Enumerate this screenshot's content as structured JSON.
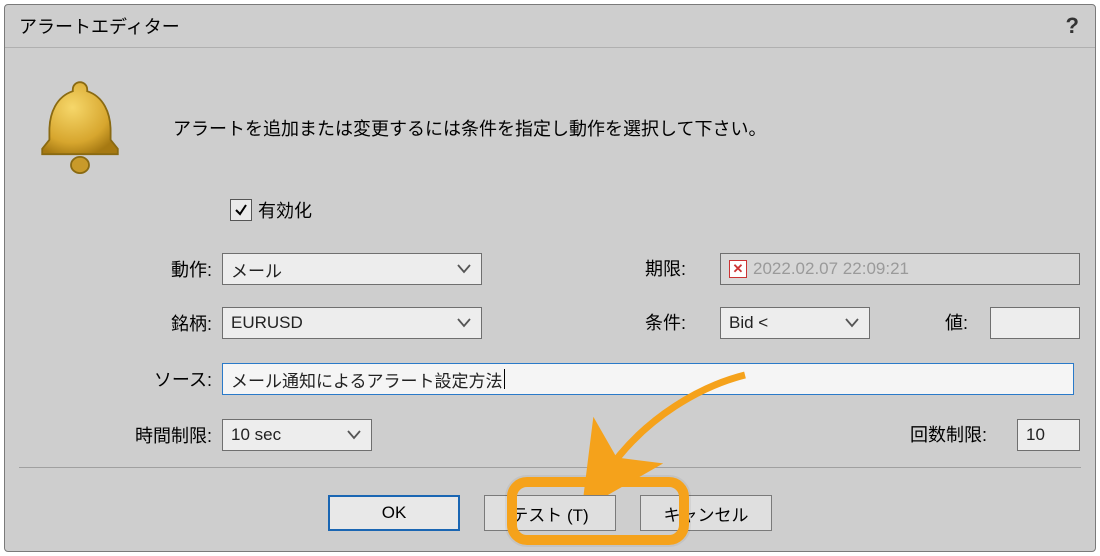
{
  "titlebar": {
    "title": "アラートエディター",
    "help_tooltip": "?"
  },
  "instruction": "アラートを追加または変更するには条件を指定し動作を選択して下さい。",
  "enable": {
    "label": "有効化",
    "checked": true
  },
  "labels": {
    "action": "動作:",
    "symbol": "銘柄:",
    "source": "ソース:",
    "time_limit": "時間制限:",
    "expiry": "期限:",
    "condition": "条件:",
    "value": "値:",
    "count_limit": "回数制限:"
  },
  "values": {
    "action": "メール",
    "symbol": "EURUSD",
    "source": "メール通知によるアラート設定方法",
    "time_limit": "10 sec",
    "expiry": "2022.02.07 22:09:21",
    "condition": "Bid <",
    "value": "",
    "count_limit": "10"
  },
  "buttons": {
    "ok": "OK",
    "test": "テスト (T)",
    "cancel": "キャンセル"
  },
  "annotation": {
    "highlight_target": "test-button"
  }
}
